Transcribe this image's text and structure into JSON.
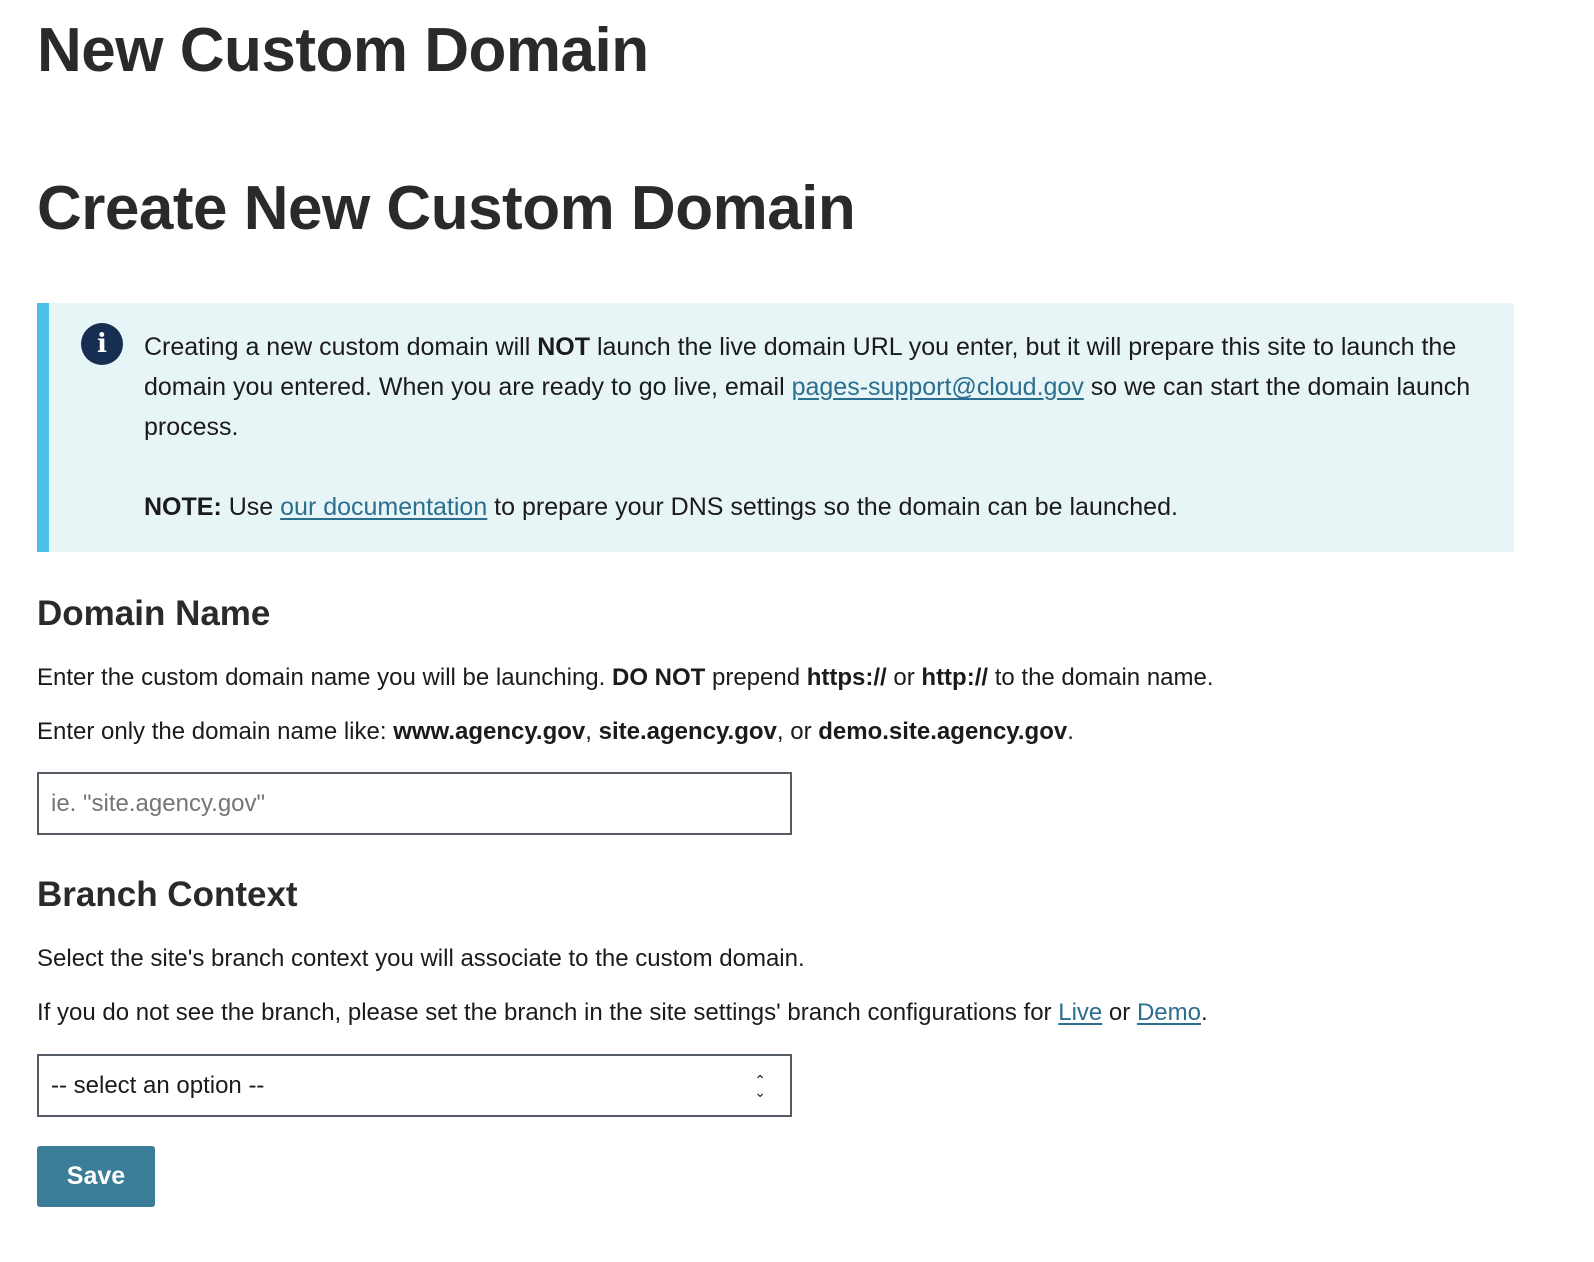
{
  "page": {
    "title": "New Custom Domain"
  },
  "form": {
    "title": "Create New Custom Domain"
  },
  "alert": {
    "icon": "info-icon",
    "p1_before": "Creating a new custom domain will ",
    "p1_bold": "NOT",
    "p1_mid": " launch the live domain URL you enter, but it will prepare this site to launch the domain you entered. When you are ready to go live, email ",
    "p1_link": "pages-support@cloud.gov",
    "p1_after": " so we can start the domain launch process.",
    "p2_bold": "NOTE:",
    "p2_before": " Use ",
    "p2_link": "our documentation",
    "p2_after": " to prepare your DNS settings so the domain can be launched."
  },
  "domain_name": {
    "heading": "Domain Name",
    "help1_a": "Enter the custom domain name you will be launching. ",
    "help1_b": "DO NOT",
    "help1_c": " prepend ",
    "help1_d": "https://",
    "help1_e": " or ",
    "help1_f": "http://",
    "help1_g": " to the domain name.",
    "help2_a": "Enter only the domain name like: ",
    "help2_b": "www.agency.gov",
    "help2_c": ", ",
    "help2_d": "site.agency.gov",
    "help2_e": ", or ",
    "help2_f": "demo.site.agency.gov",
    "help2_g": ".",
    "input_value": "",
    "placeholder": "ie. \"site.agency.gov\""
  },
  "branch_context": {
    "heading": "Branch Context",
    "help1": "Select the site's branch context you will associate to the custom domain.",
    "help2_a": "If you do not see the branch, please set the branch in the site settings' branch configurations for ",
    "help2_live": "Live",
    "help2_or": " or ",
    "help2_demo": "Demo",
    "help2_end": ".",
    "select_value": "-- select an option --"
  },
  "actions": {
    "save_label": "Save"
  }
}
